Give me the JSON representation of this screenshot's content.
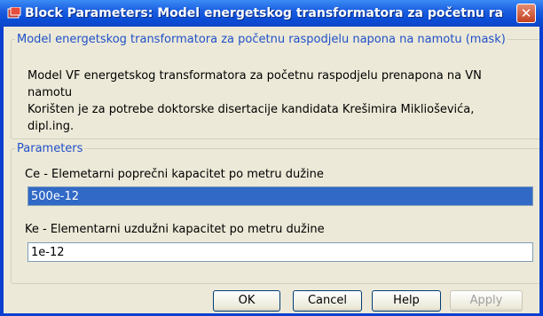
{
  "window": {
    "title": "Block Parameters: Model energetskog transformatora za početnu raspo...",
    "close_glyph": "✕"
  },
  "mask": {
    "legend": "Model energetskog transformatora za početnu raspodjelu napona na namotu (mask)",
    "description_lines": [
      "Model VF energetskog transformatora za početnu raspodjelu prenapona na VN",
      "namotu",
      "Korišten je za potrebe doktorske disertacije kandidata Krešimira Miklioševića,",
      "dipl.ing."
    ]
  },
  "parameters": {
    "legend": "Parameters",
    "fields": [
      {
        "label": "Ce - Elemetarni poprečni kapacitet po metru dužine",
        "value": "500e-12"
      },
      {
        "label": "Ke - Elementarni uzdužni kapacitet po metru dužine",
        "value": "1e-12"
      }
    ]
  },
  "buttons": {
    "ok": "OK",
    "cancel": "Cancel",
    "help": "Help",
    "apply": "Apply"
  },
  "icons": {
    "app": "simulink-block-icon",
    "close": "close-icon"
  },
  "colors": {
    "titlebar": "#0d4fd8",
    "client": "#ece9d8",
    "selection": "#3169c6",
    "legend_text": "#2050c8"
  }
}
